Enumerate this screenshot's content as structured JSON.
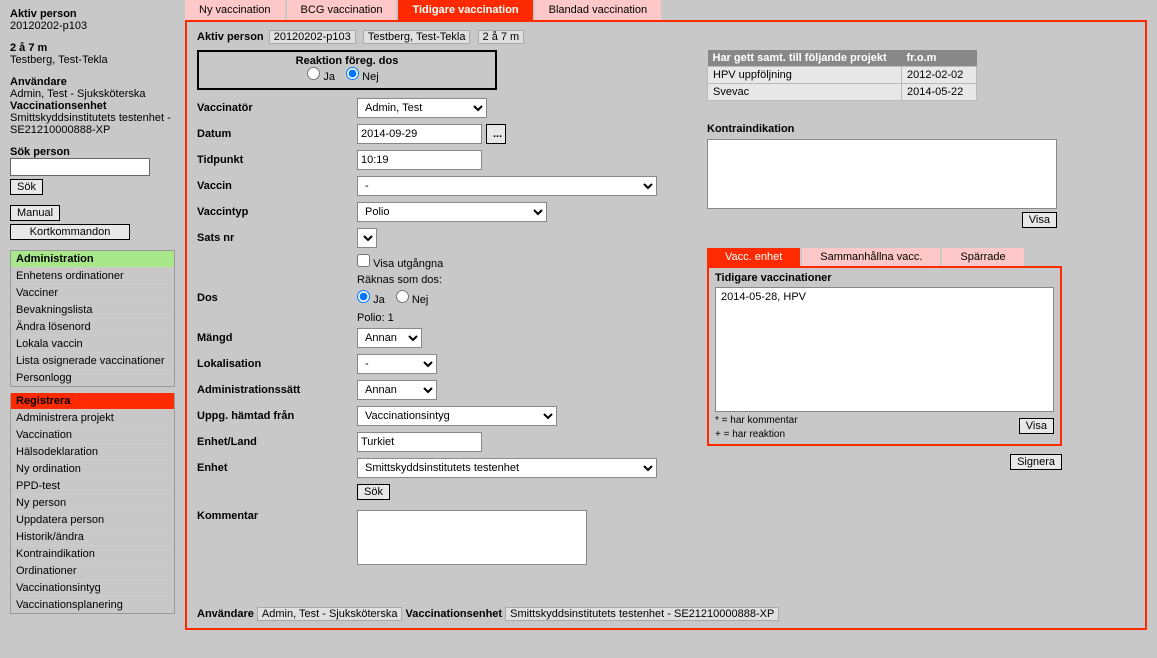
{
  "sidebar": {
    "aktiv_person_label": "Aktiv person",
    "aktiv_person_id": "20120202-p103",
    "age": "2 å 7 m",
    "name": "Testberg, Test-Tekla",
    "anvandare_label": "Användare",
    "anvandare_value": "Admin, Test - Sjuksköterska",
    "vacc_enhet_label": "Vaccinationsenhet",
    "vacc_enhet_value": "Smittskyddsinstitutets testenhet - SE21210000888-XP",
    "sok_person_label": "Sök person",
    "sok_btn": "Sök",
    "manual_btn": "Manual",
    "kortkommandon_btn": "Kortkommandon",
    "admin_header": "Administration",
    "admin_items": [
      "Enhetens ordinationer",
      "Vacciner",
      "Bevakningslista",
      "Ändra lösenord",
      "Lokala vaccin",
      "Lista osignerade vaccinationer",
      "Personlogg"
    ],
    "reg_header": "Registrera",
    "reg_items": [
      "Administrera projekt",
      "Vaccination",
      "Hälsodeklaration",
      "Ny ordination",
      "PPD-test",
      "Ny person",
      "Uppdatera person",
      "Historik/ändra",
      "Kontraindikation",
      "Ordinationer",
      "Vaccinationsintyg",
      "Vaccinationsplanering"
    ]
  },
  "tabs": {
    "items": [
      "Ny vaccination",
      "BCG vaccination",
      "Tidigare vaccination",
      "Blandad vaccination"
    ],
    "active_index": 2
  },
  "panel": {
    "aktiv_person_label": "Aktiv person",
    "aktiv_person_id": "20120202-p103",
    "aktiv_person_name": "Testberg, Test-Tekla",
    "aktiv_person_age": "2 å 7 m",
    "reaktion": {
      "title": "Reaktion föreg. dos",
      "ja": "Ja",
      "nej": "Nej",
      "selected": "nej"
    },
    "form": {
      "vaccinator_label": "Vaccinatör",
      "vaccinator_value": "Admin, Test",
      "datum_label": "Datum",
      "datum_value": "2014-09-29",
      "tidpunkt_label": "Tidpunkt",
      "tidpunkt_value": "10:19",
      "vaccin_label": "Vaccin",
      "vaccin_value": "-",
      "vaccintyp_label": "Vaccintyp",
      "vaccintyp_value": "Polio",
      "sats_label": "Sats nr",
      "visa_utgangna": "Visa utgångna",
      "raknas_label": "Räknas som dos:",
      "dos_label": "Dos",
      "dos_ja": "Ja",
      "dos_nej": "Nej",
      "polio_count": "Polio: 1",
      "mangd_label": "Mängd",
      "mangd_value": "Annan",
      "lokalisation_label": "Lokalisation",
      "lokalisation_value": "-",
      "adminsatt_label": "Administrationssätt",
      "adminsatt_value": "Annan",
      "uppg_label": "Uppg. hämtad från",
      "uppg_value": "Vaccinationsintyg",
      "enhetland_label": "Enhet/Land",
      "enhetland_value": "Turkiet",
      "enhet_label": "Enhet",
      "enhet_value": "Smittskyddsinstitutets testenhet",
      "sok_btn": "Sök",
      "kommentar_label": "Kommentar"
    },
    "projects": {
      "col1": "Har gett samt. till följande projekt",
      "col2": "fr.o.m",
      "rows": [
        {
          "name": "HPV uppföljning",
          "date": "2012-02-02"
        },
        {
          "name": "Svevac",
          "date": "2014-05-22"
        }
      ]
    },
    "kontra_label": "Kontraindikation",
    "visa_btn": "Visa",
    "sub_tabs": {
      "items": [
        "Vacc. enhet",
        "Sammanhållna vacc.",
        "Spärrade"
      ],
      "active_index": 0
    },
    "prev_vacc": {
      "title": "Tidigare vaccinationer",
      "items": [
        "2014-05-28, HPV"
      ],
      "legend1": "* = har kommentar",
      "legend2": "+ = har reaktion",
      "visa_btn": "Visa"
    },
    "signera_btn": "Signera",
    "footer": {
      "anvandare_label": "Användare",
      "anvandare_value": "Admin, Test - Sjuksköterska",
      "vacc_enhet_label": "Vaccinationsenhet",
      "vacc_enhet_value": "Smittskyddsinstitutets testenhet - SE21210000888-XP"
    }
  }
}
